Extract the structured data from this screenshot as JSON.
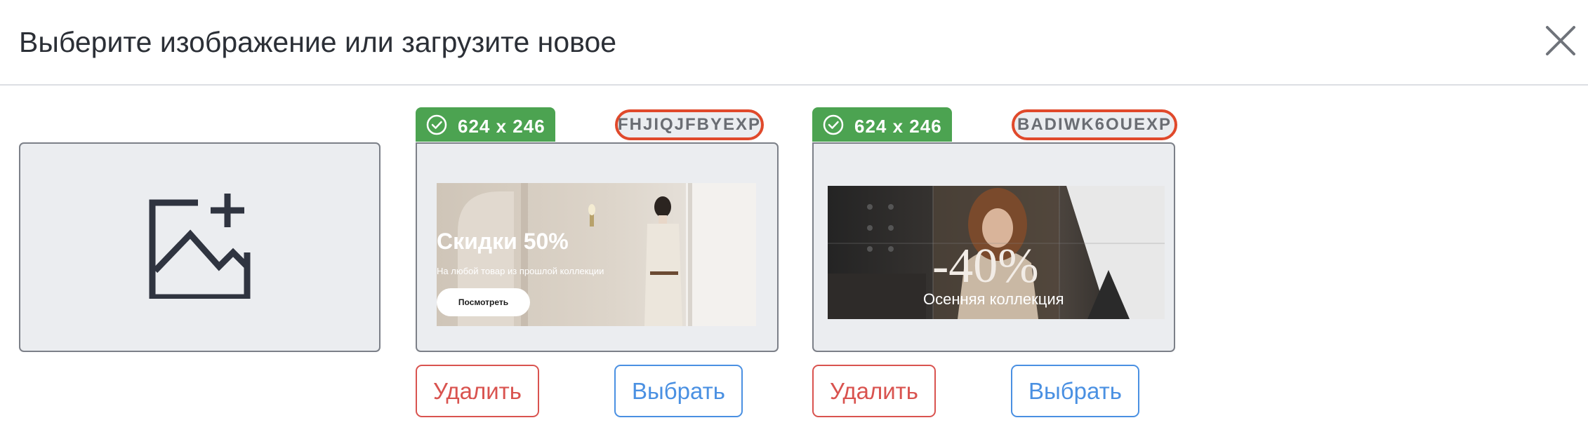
{
  "header": {
    "title": "Выберите изображение или загрузите новое",
    "close_icon": "close-icon"
  },
  "upload": {
    "icon": "add-image-icon"
  },
  "images": [
    {
      "size": "624 x 246",
      "code": "FHJIQJFBYEXP",
      "banner": {
        "headline": "Скидки 50%",
        "subtitle": "На любой товар из прошлой коллекции",
        "button": "Посмотреть"
      },
      "delete_label": "Удалить",
      "select_label": "Выбрать"
    },
    {
      "size": "624 x 246",
      "code": "BADIWK6OUEXP",
      "banner": {
        "headline": "-40%",
        "subtitle": "Осенняя коллекция"
      },
      "delete_label": "Удалить",
      "select_label": "Выбрать"
    }
  ],
  "colors": {
    "badge_green": "#4ca351",
    "code_outline": "#e0492b",
    "delete": "#d9534f",
    "select": "#4a90e2",
    "card_bg": "#ebedf0"
  }
}
